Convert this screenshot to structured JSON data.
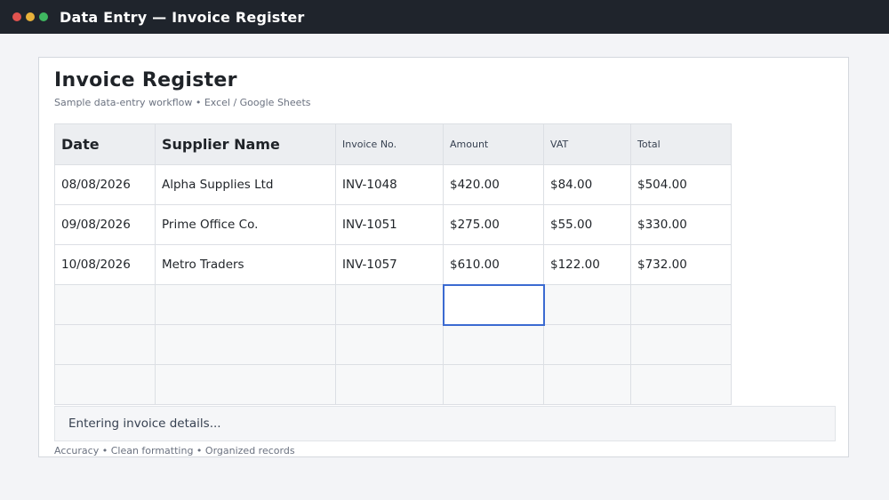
{
  "window": {
    "title": "Data Entry — Invoice Register",
    "dot_colors": [
      "#e0534f",
      "#e8b13a",
      "#3fb760"
    ]
  },
  "sheet": {
    "title": "Invoice Register",
    "subtitle": "Sample data-entry workflow • Excel / Google Sheets",
    "columns": [
      "Date",
      "Supplier Name",
      "Invoice No.",
      "Amount",
      "VAT",
      "Total"
    ],
    "rows": [
      [
        "08/08/2026",
        "Alpha Supplies Ltd",
        "INV-1048",
        "$420.00",
        "$84.00",
        "$504.00"
      ],
      [
        "09/08/2026",
        "Prime Office Co.",
        "INV-1051",
        "$275.00",
        "$55.00",
        "$330.00"
      ],
      [
        "10/08/2026",
        "Metro Traders",
        "INV-1057",
        "$610.00",
        "$122.00",
        "$732.00"
      ],
      [
        "",
        "",
        "",
        "",
        "",
        ""
      ],
      [
        "",
        "",
        "",
        "",
        "",
        ""
      ],
      [
        "",
        "",
        "",
        "",
        "",
        ""
      ]
    ],
    "active_cell": {
      "row": 4,
      "col": 4
    },
    "status": "Entering invoice details...",
    "footer": "Accuracy • Clean formatting • Organized records",
    "accent_color": "#3b6ad1"
  }
}
